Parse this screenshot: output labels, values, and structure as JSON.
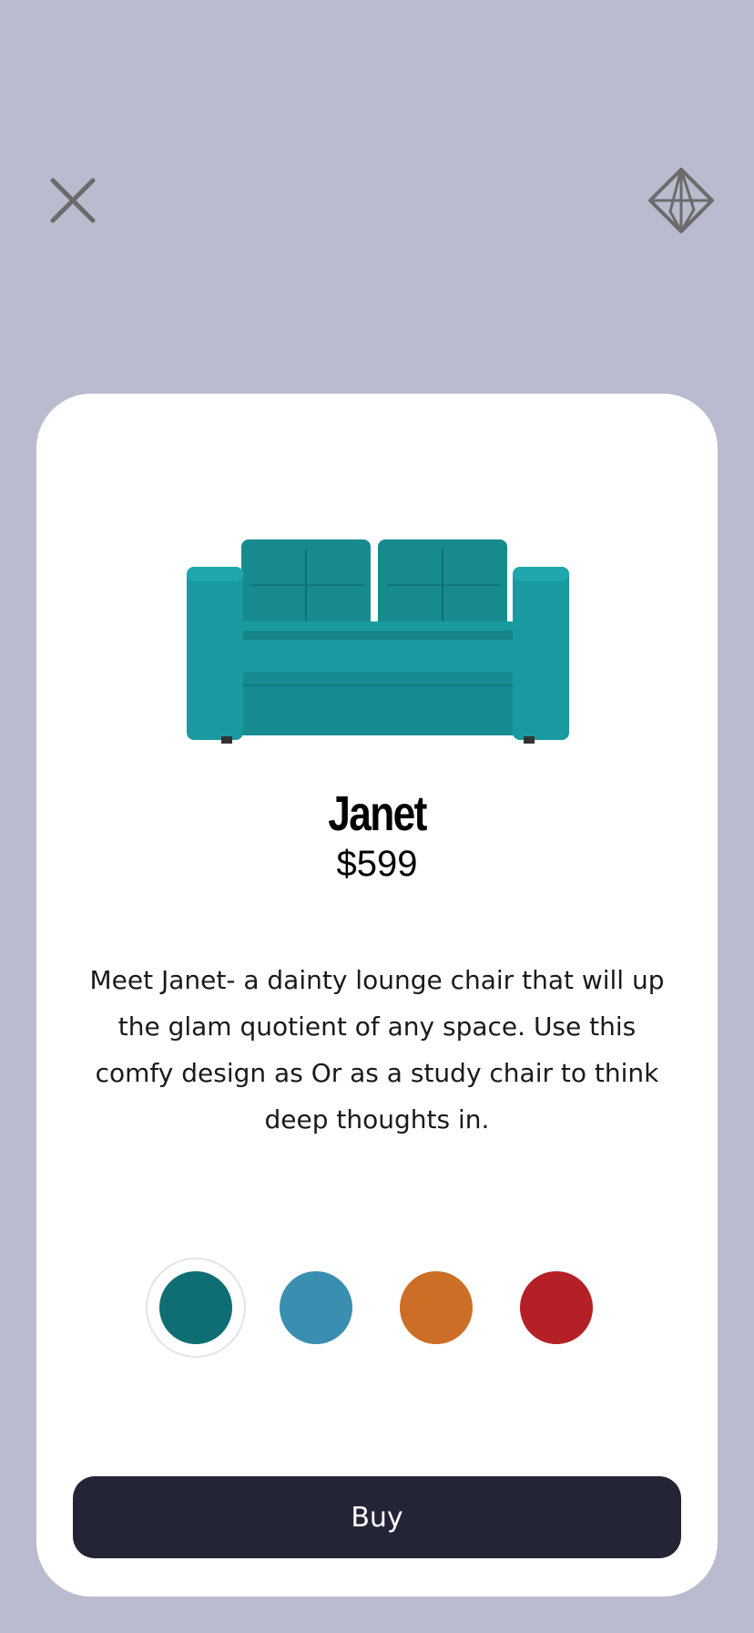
{
  "header": {
    "close_icon": "close-icon",
    "ar_icon": "ar-cube-icon"
  },
  "product": {
    "name": "Janet",
    "price": "$599",
    "description": "Meet Janet- a dainty lounge chair that will up the glam quotient of any space. Use this comfy design as Or as a study chair to think deep thoughts in.",
    "image": "sofa-image"
  },
  "colors": {
    "selected": "#0e6e73",
    "options": [
      "#0e6e73",
      "#3a8fb0",
      "#cc6e25",
      "#b52026"
    ],
    "sofa_fabric": "#1a9aa0",
    "background": "#b9bccf",
    "button": "#232536"
  },
  "actions": {
    "buy_label": "Buy"
  }
}
